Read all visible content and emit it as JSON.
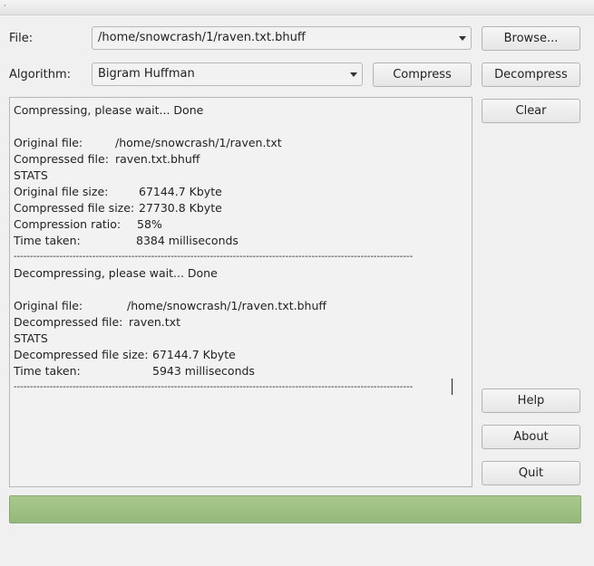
{
  "titlebar": {
    "glyph": "·"
  },
  "file": {
    "label": "File:",
    "value": "/home/snowcrash/1/raven.txt.bhuff"
  },
  "algorithm": {
    "label": "Algorithm:",
    "value": "Bigram Huffman"
  },
  "buttons": {
    "browse": "Browse...",
    "compress": "Compress",
    "decompress": "Decompress",
    "clear": "Clear",
    "help": "Help",
    "about": "About",
    "quit": "Quit"
  },
  "output": {
    "compress_status": "Compressing, please wait... Done",
    "compress_original_label": "Original file:",
    "compress_original_value": "/home/snowcrash/1/raven.txt",
    "compress_compressed_label": "Compressed file:",
    "compress_compressed_value": "raven.txt.bhuff",
    "stats1": "STATS",
    "orig_size_label": "Original file size:",
    "orig_size_value": "67144.7 Kbyte",
    "comp_size_label": "Compressed file size:",
    "comp_size_value": "27730.8 Kbyte",
    "ratio_label": "Compression ratio:",
    "ratio_value": "58%",
    "time1_label": "Time taken:",
    "time1_value": "8384 milliseconds",
    "separator": "--------------------------------------------------------------------------------------------------------------------------",
    "decompress_status": "Decompressing, please wait... Done",
    "decompress_original_label": "Original file:",
    "decompress_original_value": "/home/snowcrash/1/raven.txt.bhuff",
    "decompressed_label": "Decompressed file:",
    "decompressed_value": "raven.txt",
    "stats2": "STATS",
    "decomp_size_label": "Decompressed file size:",
    "decomp_size_value": "67144.7 Kbyte",
    "time2_label": "Time taken:",
    "time2_value": "5943 milliseconds"
  },
  "progress": {
    "value": 1.0
  },
  "colors": {
    "progress_fill": "#9fc185",
    "window_bg": "#f0f0f0"
  }
}
